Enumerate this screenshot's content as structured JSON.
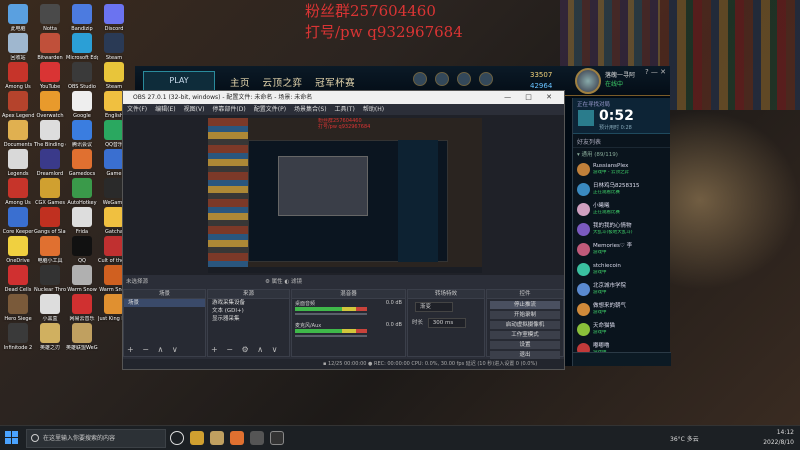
{
  "watermark": {
    "line1": "粉丝群257604460",
    "line2": "打号/pw  q932967684"
  },
  "desktop_icons": [
    {
      "label": "此电脑",
      "color": "#5aa0e0"
    },
    {
      "label": "Notta",
      "color": "#4a4a4a"
    },
    {
      "label": "Bandizip",
      "color": "#4c7be0"
    },
    {
      "label": "Discord",
      "color": "#6b73f0"
    },
    {
      "label": "回收站",
      "color": "#9fb7cf"
    },
    {
      "label": "Bitwarden",
      "color": "#c0503a"
    },
    {
      "label": "Microsoft Edge",
      "color": "#2b9fd6"
    },
    {
      "label": "Steam",
      "color": "#2a3a55"
    },
    {
      "label": "Among Us",
      "color": "#c6342a"
    },
    {
      "label": "YouTube",
      "color": "#d93434"
    },
    {
      "label": "OBS Studio",
      "color": "#3a3a3a"
    },
    {
      "label": "Steam",
      "color": "#e8c53a"
    },
    {
      "label": "Apex Legends",
      "color": "#b5432c"
    },
    {
      "label": "Overwatch",
      "color": "#e89a2c"
    },
    {
      "label": "Google",
      "color": "#eeeeee"
    },
    {
      "label": "English",
      "color": "#f0c040"
    },
    {
      "label": "Documents",
      "color": "#e0b050"
    },
    {
      "label": "The Binding of Isaac",
      "color": "#dddddd"
    },
    {
      "label": "腾讯会议",
      "color": "#3a7de0"
    },
    {
      "label": "QQ音乐",
      "color": "#2aa860"
    },
    {
      "label": "Legends",
      "color": "#d9d9d9"
    },
    {
      "label": "Dreamlord",
      "color": "#3a3a8a"
    },
    {
      "label": "Gamedocs",
      "color": "#e07030"
    },
    {
      "label": "Game",
      "color": "#3a6fd0"
    },
    {
      "label": "Among Us",
      "color": "#c6342a"
    },
    {
      "label": "CGX Games",
      "color": "#d0a030"
    },
    {
      "label": "AutoHotkey",
      "color": "#3a9a4a"
    },
    {
      "label": "WeGame",
      "color": "#2a2a2a"
    },
    {
      "label": "Core Keeper",
      "color": "#3a6fd0"
    },
    {
      "label": "Gangs of Slaughter",
      "color": "#c03020"
    },
    {
      "label": "Frida",
      "color": "#dddddd"
    },
    {
      "label": "Gatcha",
      "color": "#f0c040"
    },
    {
      "label": "OneDrive",
      "color": "#f0d040"
    },
    {
      "label": "电脑小工具",
      "color": "#e07030"
    },
    {
      "label": "QQ",
      "color": "#111111"
    },
    {
      "label": "Cult of the Lamb Demo",
      "color": "#c03030"
    },
    {
      "label": "Dead Cells",
      "color": "#d03030"
    },
    {
      "label": "Nuclear Throne",
      "color": "#333333"
    },
    {
      "label": "Warm Snow",
      "color": "#b0b0b0"
    },
    {
      "label": "Warm Snow",
      "color": "#d06020"
    },
    {
      "label": "Hero Siege",
      "color": "#7a5a3a"
    },
    {
      "label": "小黑盒",
      "color": "#dddddd"
    },
    {
      "label": "网易云音乐",
      "color": "#d03030"
    },
    {
      "label": "Just King Demo",
      "color": "#e09030"
    },
    {
      "label": "Infinitode 2",
      "color": "#3a3a3a"
    },
    {
      "label": "英雄之刃",
      "color": "#d0b060"
    },
    {
      "label": "英雄联盟WeGame版",
      "color": "#c0a060"
    }
  ],
  "lol": {
    "play_label": "PLAY",
    "nav": [
      "主页",
      "云顶之弈",
      "冠军杯赛"
    ],
    "blue_essence": "33507",
    "rp": "42964",
    "profile_name": "落魄一寻阿",
    "profile_status": "在线中",
    "window_controls": "?  —  ✕"
  },
  "social": {
    "queue_label": "正在寻找对局",
    "queue_time": "0:52",
    "queue_sub": "预计用时 0:28",
    "friends_header": "好友列表",
    "group_label": "▾ 通用 (89/119)",
    "friends": [
      {
        "name": "RussiansPlex",
        "status": "游戏中 - 云顶之弈",
        "color": "#c0803a"
      },
      {
        "name": "日林鸡乌8258315",
        "status": "正在观看比赛",
        "color": "#3a8ac0"
      },
      {
        "name": "小曦曦",
        "status": "正在观看比赛",
        "color": "#d0a0c0"
      },
      {
        "name": "我的我的心情物",
        "status": "大乱斗(极地大乱斗)",
        "color": "#7a5ac0"
      },
      {
        "name": "Memories♡ 李",
        "status": "游戏中",
        "color": "#c05a7a"
      },
      {
        "name": "stchiecoin",
        "status": "游戏中",
        "color": "#3ac0a0"
      },
      {
        "name": "北京城市学院",
        "status": "游戏中",
        "color": "#5a8ad0"
      },
      {
        "name": "做想来的朝气",
        "status": "游戏中",
        "color": "#d08a3a"
      },
      {
        "name": "天命猫猫",
        "status": "游戏中",
        "color": "#8ac03a"
      },
      {
        "name": "嘟嘟噜",
        "status": "游戏中",
        "color": "#c03a3a"
      }
    ]
  },
  "obs": {
    "title": "OBS 27.0.1 (32-bit, windows) - 配置文件: 未命名 - 场景: 未命名",
    "window_controls": "— □ ✕",
    "menu": [
      "文件(F)",
      "编辑(E)",
      "视图(V)",
      "停靠部件(D)",
      "配置文件(P)",
      "场景集合(S)",
      "工具(T)",
      "帮助(H)"
    ],
    "controls_left": "未选择源",
    "controls_mid": "⚙ 属性   ◐ 滤镜",
    "docks": {
      "scenes_title": "场景",
      "scenes": [
        "场景"
      ],
      "sources_title": "来源",
      "sources": [
        "游戏采集设备",
        "文本 (GDI+)",
        "显示器采集"
      ],
      "mixer_title": "混音器",
      "mixer": [
        {
          "name": "桌面音频",
          "db": "0.0 dB"
        },
        {
          "name": "麦克风/Aux",
          "db": "0.0 dB"
        }
      ],
      "transitions_title": "转场特效",
      "transition_type": "渐变",
      "duration_label": "时长",
      "duration_value": "300 ms",
      "controls_title": "控件",
      "buttons": [
        "停止推流",
        "开始录制",
        "启动虚拟摄像机",
        "工作室模式",
        "设置",
        "退出"
      ]
    },
    "status": "▪ 12/25   00:00:00   ● REC: 00:00:00   CPU: 0.0%, 30.00 fps   延迟 (10 秒)进入设置  0 (0.0%)"
  },
  "taskbar": {
    "search_placeholder": "在这里输入你要搜索的内容",
    "weather": "36°C 多云",
    "time": "14:12",
    "date": "2022/8/10"
  }
}
